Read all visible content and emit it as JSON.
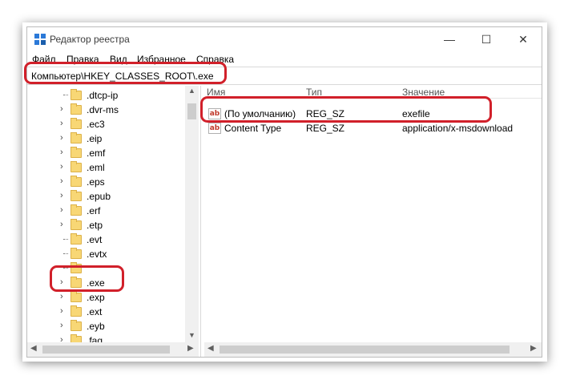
{
  "window": {
    "title": "Редактор реестра",
    "minimize_glyph": "—",
    "maximize_glyph": "☐",
    "close_glyph": "✕"
  },
  "menu": [
    "Файл",
    "Правка",
    "Вид",
    "Избранное",
    "Справка"
  ],
  "address": {
    "path": "Компьютер\\HKEY_CLASSES_ROOT\\.exe"
  },
  "tree": {
    "items": [
      {
        "label": ".dtcp-ip",
        "expandable": false
      },
      {
        "label": ".dvr-ms",
        "expandable": true
      },
      {
        "label": ".ec3",
        "expandable": true
      },
      {
        "label": ".eip",
        "expandable": true
      },
      {
        "label": ".emf",
        "expandable": true
      },
      {
        "label": ".eml",
        "expandable": true
      },
      {
        "label": ".eps",
        "expandable": true
      },
      {
        "label": ".epub",
        "expandable": true
      },
      {
        "label": ".erf",
        "expandable": true
      },
      {
        "label": ".etp",
        "expandable": true
      },
      {
        "label": ".evt",
        "expandable": false
      },
      {
        "label": ".evtx",
        "expandable": false
      },
      {
        "label": "",
        "expandable": false
      },
      {
        "label": ".exe",
        "expandable": true,
        "selected": true
      },
      {
        "label": ".exp",
        "expandable": true
      },
      {
        "label": ".ext",
        "expandable": true
      },
      {
        "label": ".eyb",
        "expandable": true
      },
      {
        "label": ".faq",
        "expandable": true
      }
    ]
  },
  "values": {
    "columns": [
      "Имя",
      "Тип",
      "Значение"
    ],
    "rows": [
      {
        "name": "(По умолчанию)",
        "type": "REG_SZ",
        "data": "exefile",
        "icon": "ab-string-icon"
      },
      {
        "name": "Content Type",
        "type": "REG_SZ",
        "data": "application/x-msdownload",
        "icon": "ab-string-icon"
      }
    ]
  },
  "icons": {
    "app": "registry-editor-icon",
    "chevron": "chevron-right-icon",
    "folder": "folder-icon"
  },
  "colors": {
    "highlight": "#d1202a",
    "folder": "#f8d775",
    "scrollbar": "#f0f0f0"
  }
}
